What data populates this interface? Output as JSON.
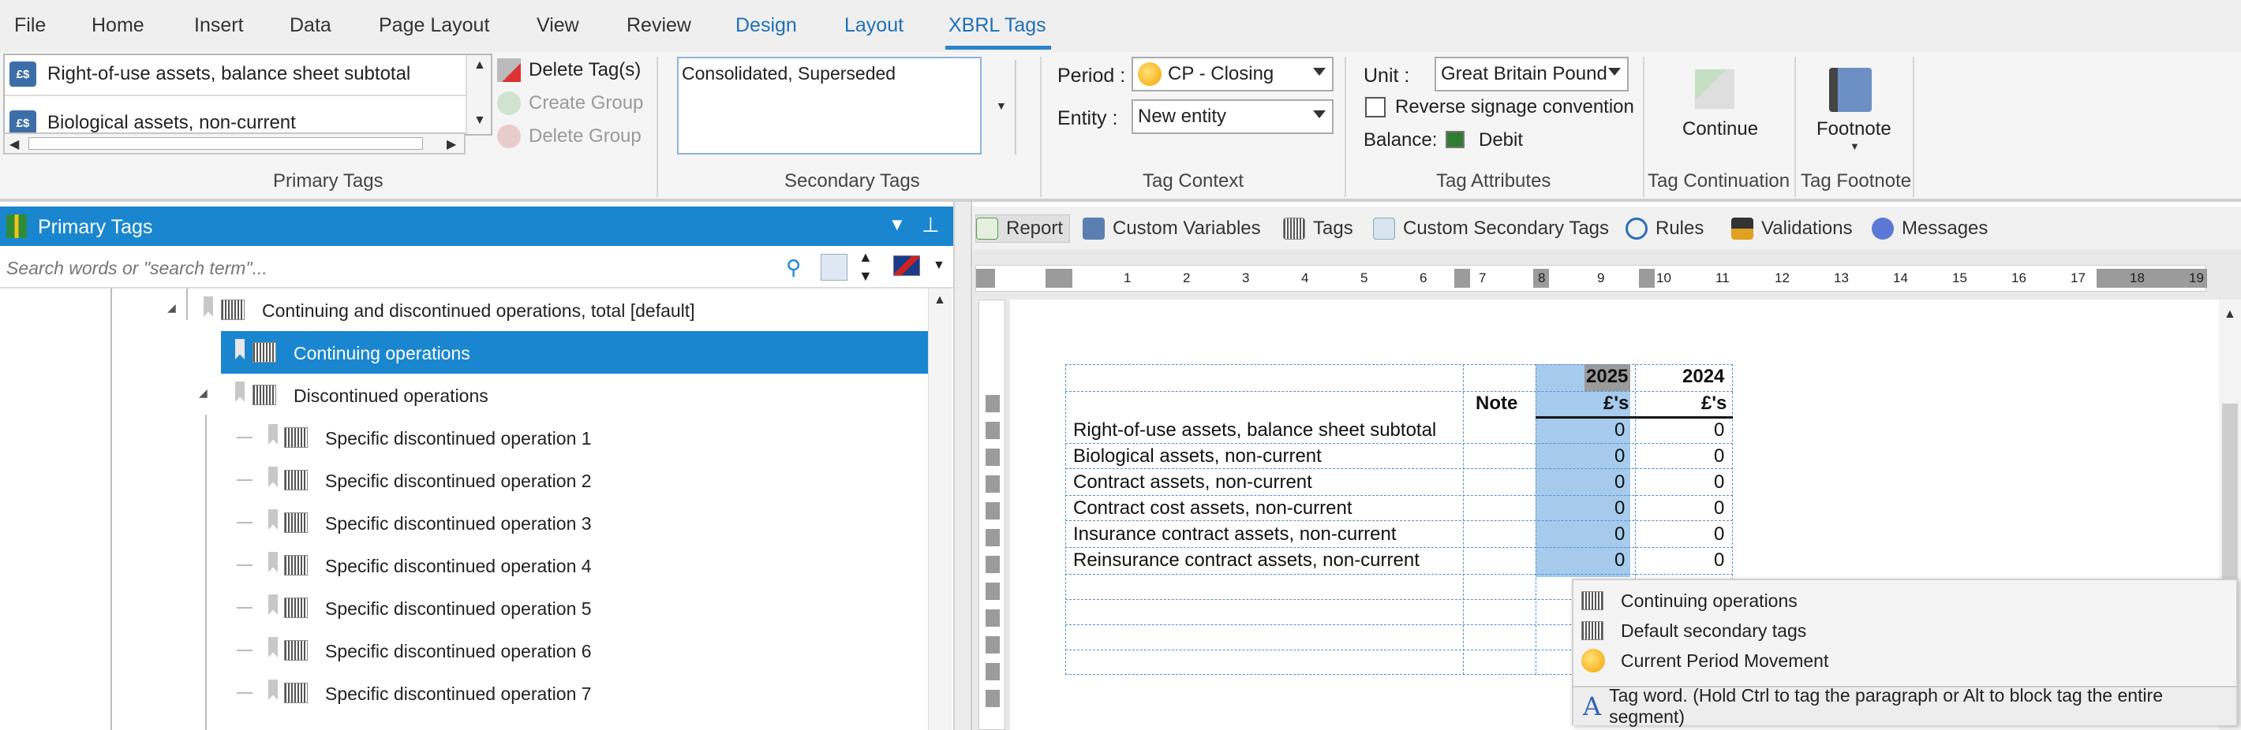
{
  "menu": {
    "tabs": [
      "File",
      "Home",
      "Insert",
      "Data",
      "Page Layout",
      "View",
      "Review",
      "Design",
      "Layout",
      "XBRL Tags"
    ],
    "active": "XBRL Tags"
  },
  "ribbon": {
    "primary_tags": {
      "items": [
        "Right-of-use assets, balance sheet subtotal",
        "Biological assets, non-current"
      ],
      "icon_text": "£$",
      "delete_tags": "Delete Tag(s)",
      "create_group": "Create Group",
      "delete_group": "Delete Group",
      "title": "Primary Tags"
    },
    "secondary_tags": {
      "value": "Consolidated, Superseded",
      "title": "Secondary Tags"
    },
    "tag_context": {
      "period_label": "Period :",
      "period_value": "CP - Closing",
      "entity_label": "Entity :",
      "entity_value": "New entity",
      "title": "Tag Context"
    },
    "tag_attributes": {
      "unit_label": "Unit :",
      "unit_value": "Great Britain Pound",
      "reverse_signage": "Reverse signage convention",
      "reverse_checked": false,
      "balance_label": "Balance:",
      "balance_value": "Debit",
      "title": "Tag Attributes"
    },
    "tag_continuation": {
      "label": "Continue",
      "title": "Tag Continuation"
    },
    "tag_footnote": {
      "label": "Footnote",
      "title": "Tag Footnote"
    }
  },
  "left_pane": {
    "title": "Primary Tags",
    "search_placeholder": "Search words or \"search term\"...",
    "tree": [
      {
        "label": "Continuing and discontinued operations, total [default]",
        "level": 0,
        "selected": false
      },
      {
        "label": "Continuing operations",
        "level": 1,
        "selected": true
      },
      {
        "label": "Discontinued operations",
        "level": 1,
        "selected": false
      },
      {
        "label": "Specific discontinued operation 1",
        "level": 2,
        "selected": false
      },
      {
        "label": "Specific discontinued operation 2",
        "level": 2,
        "selected": false
      },
      {
        "label": "Specific discontinued operation 3",
        "level": 2,
        "selected": false
      },
      {
        "label": "Specific discontinued operation 4",
        "level": 2,
        "selected": false
      },
      {
        "label": "Specific discontinued operation 5",
        "level": 2,
        "selected": false
      },
      {
        "label": "Specific discontinued operation 6",
        "level": 2,
        "selected": false
      },
      {
        "label": "Specific discontinued operation 7",
        "level": 2,
        "selected": false
      }
    ]
  },
  "doc_tabs": [
    "Report",
    "Custom Variables",
    "Tags",
    "Custom Secondary Tags",
    "Rules",
    "Validations",
    "Messages"
  ],
  "ruler_numbers": [
    "1",
    "2",
    "3",
    "4",
    "5",
    "6",
    "7",
    "8",
    "9",
    "10",
    "11",
    "12",
    "13",
    "14",
    "15",
    "16",
    "17",
    "18",
    "19"
  ],
  "table": {
    "years": [
      "2025",
      "2024"
    ],
    "note_header": "Note",
    "units": [
      "£'s",
      "£'s"
    ],
    "rows": [
      {
        "label": "Right-of-use assets, balance sheet subtotal",
        "v2025": "0",
        "v2024": "0"
      },
      {
        "label": "Biological assets, non-current",
        "v2025": "0",
        "v2024": "0"
      },
      {
        "label": "Contract assets, non-current",
        "v2025": "0",
        "v2024": "0"
      },
      {
        "label": "Contract cost assets, non-current",
        "v2025": "0",
        "v2024": "0"
      },
      {
        "label": "Insurance contract assets, non-current",
        "v2025": "0",
        "v2024": "0"
      },
      {
        "label": "Reinsurance contract assets, non-current",
        "v2025": "0",
        "v2024": "0"
      }
    ],
    "hidden_zero": "0"
  },
  "popup": {
    "items": [
      "Continuing operations",
      "Default secondary tags",
      "Current Period Movement"
    ],
    "footer": "Tag word. (Hold Ctrl to tag the paragraph or Alt to block tag the entire segment)",
    "footer_icon": "A"
  },
  "colors": {
    "accent": "#1a86cf",
    "highlight": "#9dc7ec",
    "menu_active": "#1f6fb5"
  }
}
